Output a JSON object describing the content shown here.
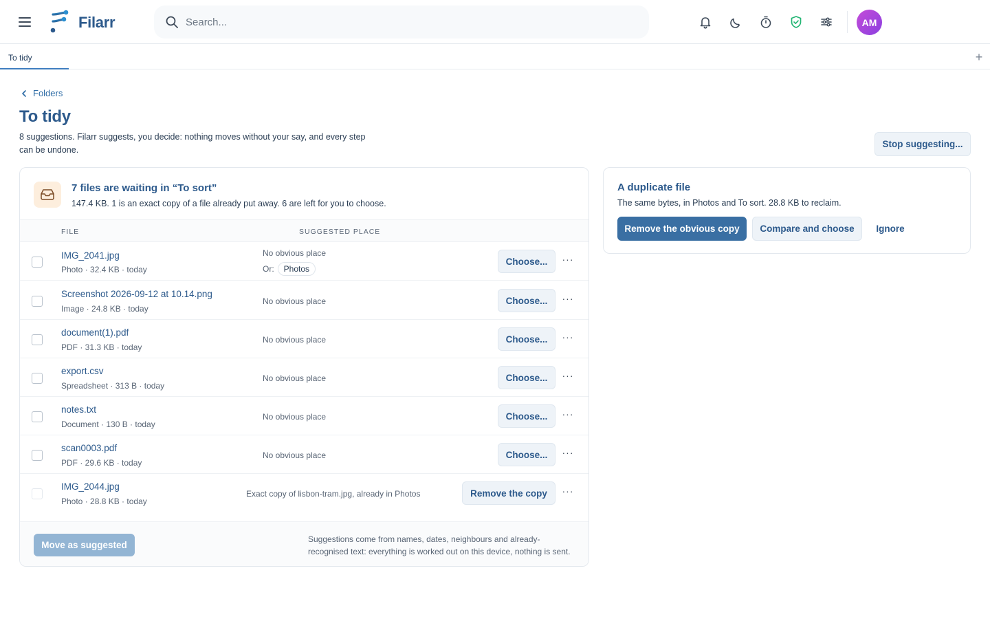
{
  "app": {
    "name": "Filarr"
  },
  "header": {
    "search_placeholder": "Search...",
    "avatar_initials": "AM",
    "accent": "#3a6fa3",
    "shield_color": "#22b573"
  },
  "tabs": [
    {
      "label": "To tidy"
    }
  ],
  "page": {
    "breadcrumb": "Folders",
    "title": "To tidy",
    "subtitle": "8 suggestions. Filarr suggests, you decide: nothing moves without your say, and every step can be undone.",
    "stop_label": "Stop suggesting..."
  },
  "card": {
    "title": "7 files are waiting in “To sort”",
    "description": "147.4 KB. 1 is an exact copy of a file already put away. 6 are left for you to choose.",
    "col_file": "FILE",
    "col_place": "SUGGESTED PLACE",
    "rows": [
      {
        "name": "IMG_2041.jpg",
        "meta": "Photo · 32.4 KB · today",
        "place": "No obvious place",
        "or_label": "Or:",
        "or_chip": "Photos",
        "action": "Choose..."
      },
      {
        "name": "Screenshot 2026-09-12 at 10.14.png",
        "meta": "Image · 24.8 KB · today",
        "place": "No obvious place",
        "action": "Choose..."
      },
      {
        "name": "document(1).pdf",
        "meta": "PDF · 31.3 KB · today",
        "place": "No obvious place",
        "action": "Choose..."
      },
      {
        "name": "export.csv",
        "meta": "Spreadsheet · 313 B · today",
        "place": "No obvious place",
        "action": "Choose..."
      },
      {
        "name": "notes.txt",
        "meta": "Document · 130 B · today",
        "place": "No obvious place",
        "action": "Choose..."
      },
      {
        "name": "scan0003.pdf",
        "meta": "PDF · 29.6 KB · today",
        "place": "No obvious place",
        "action": "Choose..."
      },
      {
        "name": "IMG_2044.jpg",
        "meta": "Photo · 28.8 KB · today",
        "place": "Exact copy of lisbon-tram.jpg, already in Photos",
        "action": "Remove the copy"
      }
    ],
    "more_label": "···",
    "move_label": "Move as suggested",
    "footnote": "Suggestions come from names, dates, neighbours and already-recognised text: everything is worked out on this device, nothing is sent."
  },
  "duplicate": {
    "title": "A duplicate file",
    "description": "The same bytes, in Photos and To sort. 28.8 KB to reclaim.",
    "primary_label": "Remove the obvious copy",
    "secondary_label": "Compare and choose",
    "ignore_label": "Ignore"
  }
}
